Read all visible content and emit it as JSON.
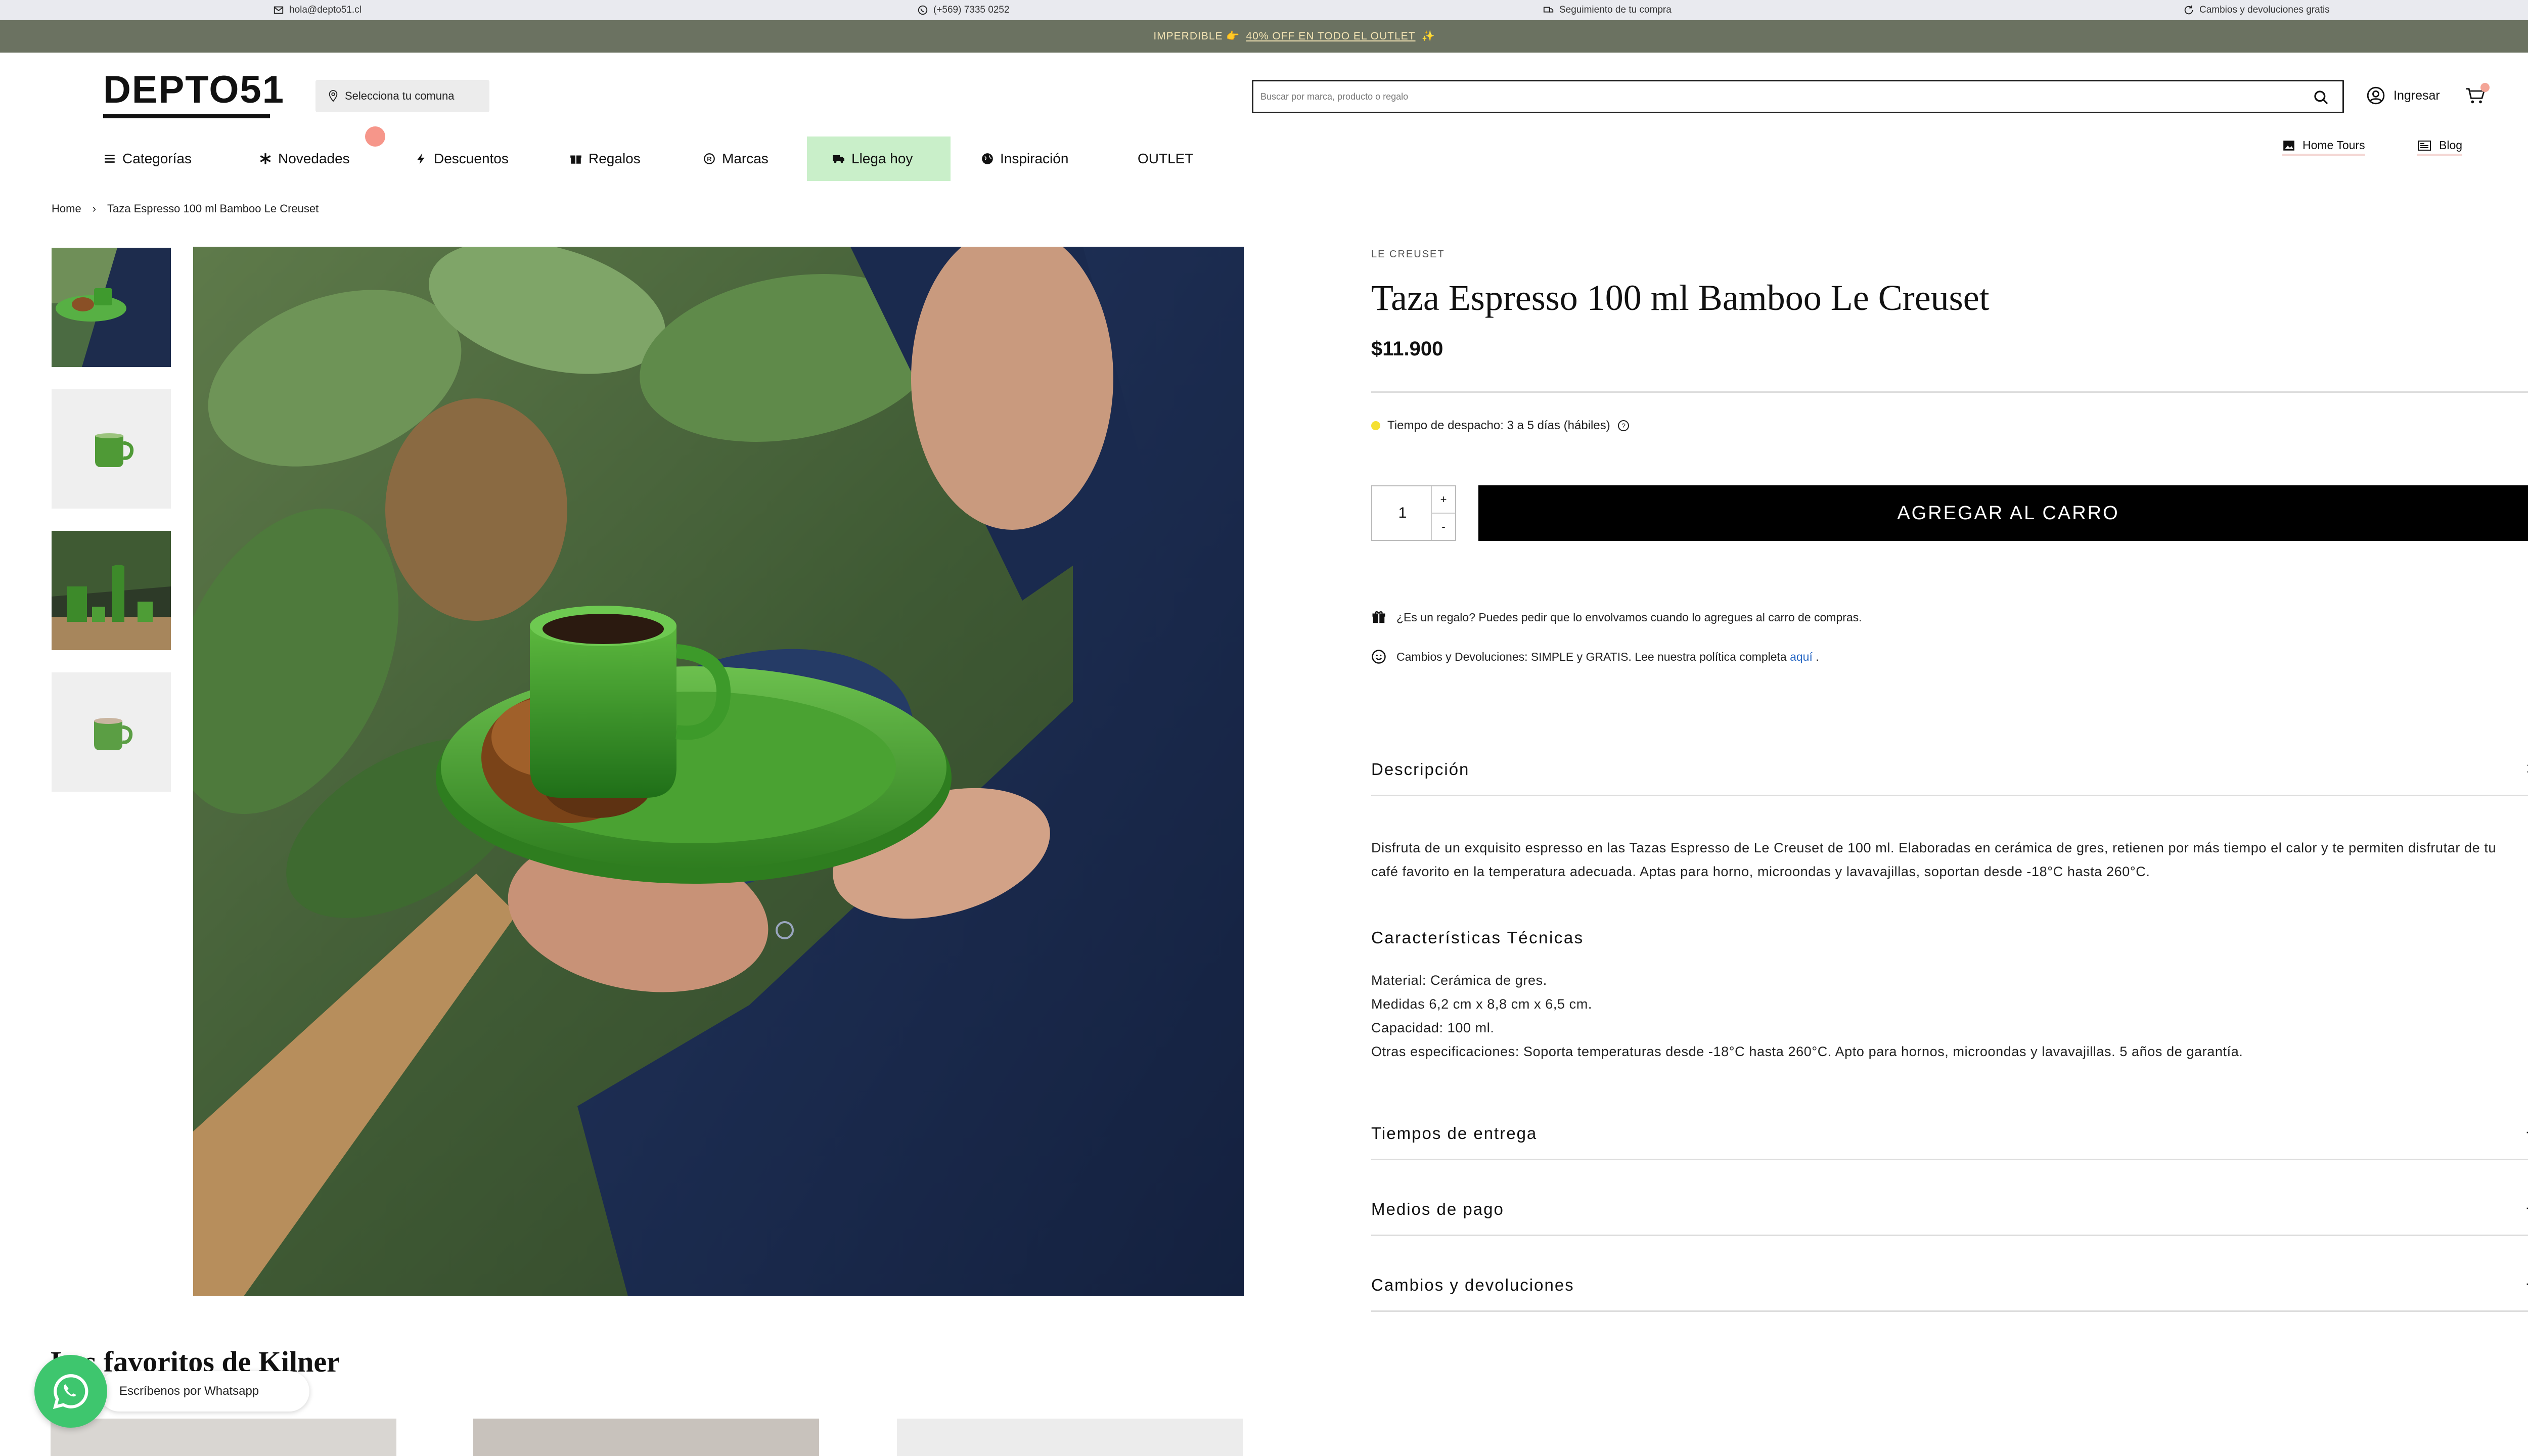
{
  "topbar": {
    "email": "hola@depto51.cl",
    "phone": "(+569) 7335 0252",
    "tracking": "Seguimiento de tu compra",
    "returns": "Cambios y devoluciones gratis"
  },
  "promo": {
    "lead": "IMPERDIBLE 👉",
    "link": "40% OFF EN TODO EL OUTLET",
    "tail": "✨"
  },
  "header": {
    "logo": "DEPTO51",
    "comuna_label": "Selecciona tu comuna",
    "search_placeholder": "Buscar por marca, producto o regalo",
    "login_label": "Ingresar"
  },
  "nav": {
    "items": [
      {
        "label": "Categorías",
        "icon": "menu-icon"
      },
      {
        "label": "Novedades",
        "icon": "asterisk-icon"
      },
      {
        "label": "Descuentos",
        "icon": "bolt-icon"
      },
      {
        "label": "Regalos",
        "icon": "gift-icon"
      },
      {
        "label": "Marcas",
        "icon": "registered-icon"
      },
      {
        "label": "Llega hoy",
        "icon": "truck-icon"
      },
      {
        "label": "Inspiración",
        "icon": "globe-icon"
      },
      {
        "label": "OUTLET",
        "icon": ""
      }
    ],
    "right": [
      {
        "label": "Home Tours",
        "icon": "photo-icon"
      },
      {
        "label": "Blog",
        "icon": "newspaper-icon"
      }
    ]
  },
  "breadcrumb": {
    "home": "Home",
    "sep": "›",
    "current": "Taza Espresso 100 ml Bamboo Le Creuset"
  },
  "product": {
    "brand": "LE CREUSET",
    "title": "Taza Espresso 100 ml Bamboo Le Creuset",
    "price": "$11.900",
    "dispatch": "Tiempo de despacho: 3 a 5 días (hábiles)",
    "quantity": "1",
    "qty_plus": "+",
    "qty_minus": "-",
    "add_to_cart": "AGREGAR AL CARRO",
    "gift_note": "¿Es un regalo? Puedes pedir que lo envolvamos cuando lo agregues al carro de compras.",
    "returns_note": "Cambios y Devoluciones: SIMPLE y GRATIS. Lee nuestra política completa",
    "returns_link": "aquí",
    "returns_end": "."
  },
  "accordion": {
    "description": {
      "title": "Descripción",
      "symbol": "×",
      "text": "Disfruta de un exquisito espresso en las Tazas Espresso de Le Creuset de 100 ml. Elaboradas en cerámica de gres, retienen por más tiempo el calor y te permiten disfrutar de tu café favorito en la temperatura adecuada. Aptas para horno, microondas y lavavajillas, soportan desde -18°C hasta 260°C.",
      "specs_title": "Características Técnicas",
      "specs": [
        "Material: Cerámica de gres.",
        "Medidas 6,2 cm x 8,8 cm x 6,5 cm.",
        "Capacidad: 100 ml.",
        "Otras especificaciones: Soporta temperaturas desde -18°C hasta 260°C. Apto para hornos, microondas y lavavajillas. 5 años de garantía."
      ]
    },
    "sections": [
      {
        "title": "Tiempos de entrega",
        "symbol": "+"
      },
      {
        "title": "Medios de pago",
        "symbol": "+"
      },
      {
        "title": "Cambios y devoluciones",
        "symbol": "+"
      }
    ]
  },
  "bottom": {
    "favorites_title": "Los favoritos de Kilner",
    "whatsapp_label": "Escríbenos por Whatsapp"
  },
  "colors": {
    "promo_bg": "#6b7261",
    "promo_text": "#f2e3b3",
    "highlight_nav": "#c9efc9",
    "accent_dot": "#f6968a",
    "cta": "#000000",
    "whatsapp": "#3ec66e",
    "dispatch_dot": "#f5e031"
  }
}
